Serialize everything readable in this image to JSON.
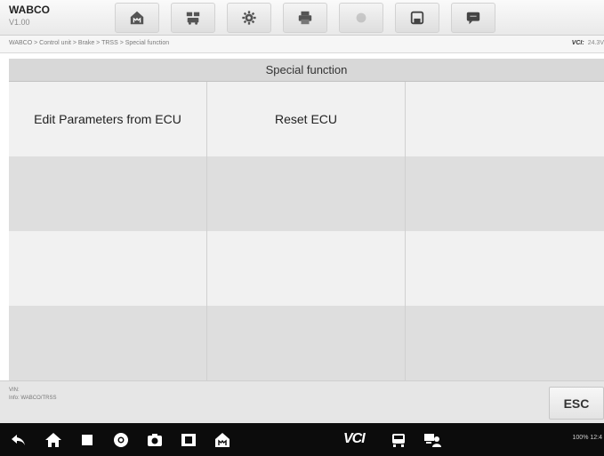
{
  "header": {
    "brand": "WABCO",
    "version": "V1.00",
    "toolbar": [
      {
        "name": "home",
        "icon": "home-icon",
        "enabled": true
      },
      {
        "name": "vehicle-swap",
        "icon": "vehicle-swap-icon",
        "enabled": true
      },
      {
        "name": "settings",
        "icon": "gear-icon",
        "enabled": true
      },
      {
        "name": "print",
        "icon": "printer-icon",
        "enabled": true
      },
      {
        "name": "help",
        "icon": "help-icon",
        "enabled": false
      },
      {
        "name": "save",
        "icon": "save-icon",
        "enabled": true
      },
      {
        "name": "data-logging",
        "icon": "message-icon",
        "enabled": true
      }
    ]
  },
  "breadcrumb": "WABCO > Control unit > Brake > TRSS > Special function",
  "vci": {
    "label": "VCI:",
    "battery": "24.3V"
  },
  "table": {
    "title": "Special function",
    "rows": [
      [
        "Edit Parameters from ECU",
        "Reset ECU",
        ""
      ],
      [
        "",
        "",
        ""
      ],
      [
        "",
        "",
        ""
      ],
      [
        "",
        "",
        ""
      ]
    ]
  },
  "info": {
    "vin_label": "VIN:",
    "info_text": "Info: WABCO/TRSS"
  },
  "esc_label": "ESC",
  "navbar": {
    "vci_text": "VCI",
    "status": "100% 12:4"
  },
  "colors": {
    "toolbar_bg": "#ececec",
    "header_row": "#d8d8d8",
    "row_light": "#f1f1f1",
    "row_dark": "#dedede",
    "navbar_bg": "#0c0c0c"
  }
}
